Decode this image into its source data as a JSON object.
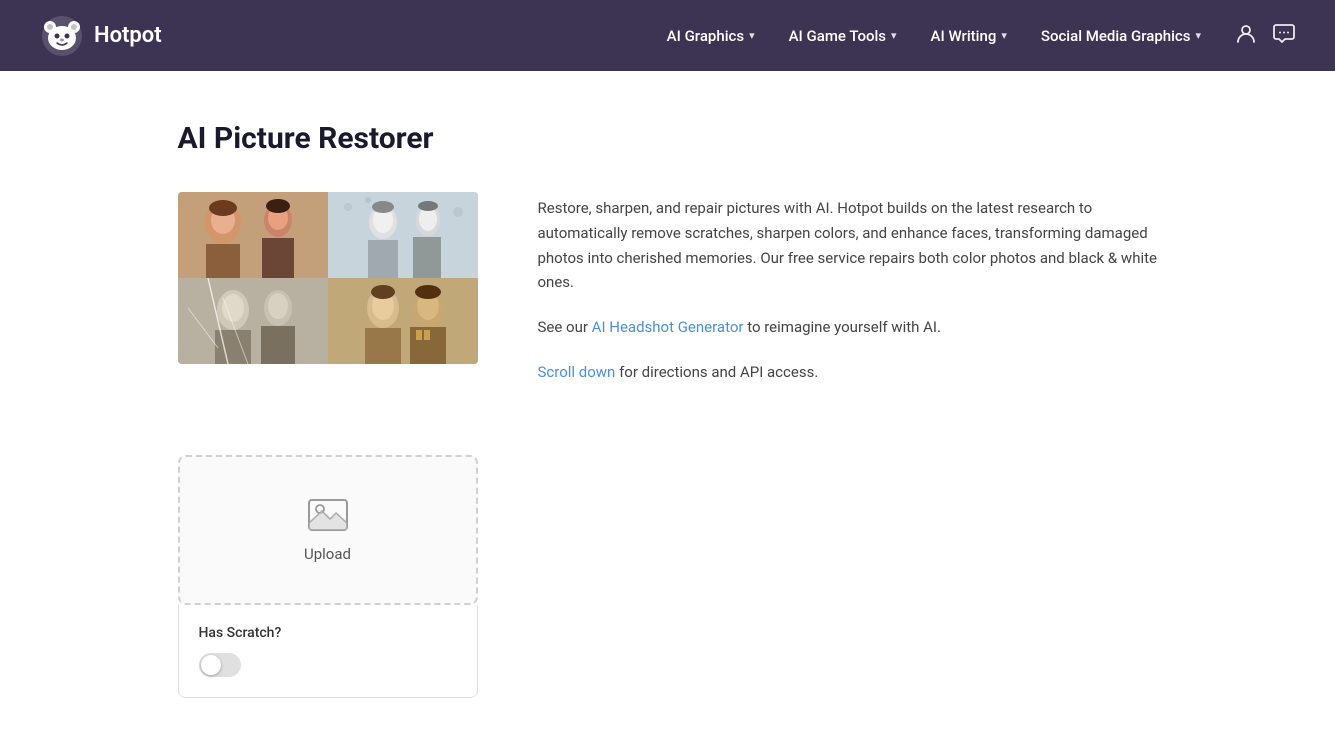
{
  "brand": {
    "name": "Hotpot"
  },
  "nav": {
    "items": [
      {
        "id": "ai-graphics",
        "label": "AI Graphics",
        "has_dropdown": true
      },
      {
        "id": "ai-game-tools",
        "label": "AI Game Tools",
        "has_dropdown": true
      },
      {
        "id": "ai-writing",
        "label": "AI Writing",
        "has_dropdown": true
      },
      {
        "id": "social-media-graphics",
        "label": "Social Media Graphics",
        "has_dropdown": true
      }
    ],
    "colors": {
      "background": "#3d3454"
    }
  },
  "page": {
    "title": "AI Picture Restorer"
  },
  "description": {
    "paragraph1": "Restore, sharpen, and repair pictures with AI. Hotpot builds on the latest research to automatically remove scratches, sharpen colors, and enhance faces, transforming damaged photos into cherished memories. Our free service repairs both color photos and black & white ones.",
    "paragraph2_prefix": "See our ",
    "link1_text": "AI Headshot Generator",
    "paragraph2_suffix": " to reimagine yourself with AI.",
    "link2_text": "Scroll down",
    "paragraph3_suffix": " for directions and API access."
  },
  "upload": {
    "label": "Upload",
    "option_label": "Has Scratch?"
  },
  "colors": {
    "link": "#4a90d9",
    "nav_bg": "#3d3454"
  }
}
